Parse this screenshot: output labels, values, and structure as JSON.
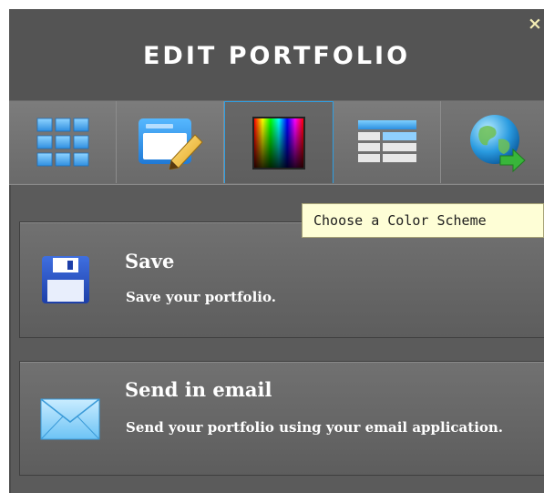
{
  "header": {
    "title": "EDIT PORTFOLIO",
    "close_glyph": "×"
  },
  "tabs": [
    {
      "name": "layout-grid",
      "icon": "grid-icon",
      "active": false
    },
    {
      "name": "edit-layout",
      "icon": "pencil-window-icon",
      "active": false
    },
    {
      "name": "color-scheme",
      "icon": "color-spectrum-icon",
      "active": true
    },
    {
      "name": "list-view",
      "icon": "list-table-icon",
      "active": false
    },
    {
      "name": "publish-web",
      "icon": "globe-arrow-icon",
      "active": false
    }
  ],
  "tooltip": {
    "text": "Choose a Color Scheme"
  },
  "actions": {
    "save": {
      "title": "Save",
      "description": "Save your portfolio.",
      "icon": "floppy-disk-icon"
    },
    "email": {
      "title": "Send in email",
      "description": "Send your portfolio using your email application.",
      "icon": "envelope-icon"
    }
  },
  "colors": {
    "panel_bg": "#5b5b5b",
    "header_bg": "#545454",
    "active_tab_border": "#2f9fe3",
    "tooltip_bg": "#fefed6",
    "text": "#ffffff"
  }
}
